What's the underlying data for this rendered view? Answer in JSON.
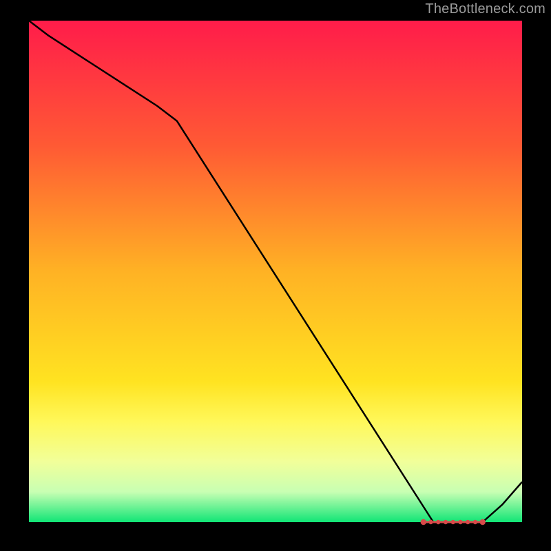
{
  "attribution": "TheBottleneck.com",
  "chart_data": {
    "type": "line",
    "title": "",
    "xlabel": "",
    "ylabel": "",
    "xlim": [
      0,
      100
    ],
    "ylim": [
      0,
      100
    ],
    "x": [
      0,
      4,
      26,
      30,
      82,
      88,
      92,
      96,
      100
    ],
    "values": [
      100,
      97,
      83,
      80,
      0,
      0,
      0,
      3.5,
      8
    ],
    "background_gradient": {
      "stops": [
        {
          "pos": 0.0,
          "color": "#ff1c4a"
        },
        {
          "pos": 0.25,
          "color": "#ff5a34"
        },
        {
          "pos": 0.5,
          "color": "#ffb224"
        },
        {
          "pos": 0.72,
          "color": "#ffe321"
        },
        {
          "pos": 0.8,
          "color": "#fff85a"
        },
        {
          "pos": 0.88,
          "color": "#f1ff9a"
        },
        {
          "pos": 0.94,
          "color": "#c8ffb3"
        },
        {
          "pos": 1.0,
          "color": "#11e576"
        }
      ]
    },
    "marker_region": {
      "x_start": 80,
      "x_end": 92,
      "y": 0,
      "color": "#d84a4a"
    }
  }
}
